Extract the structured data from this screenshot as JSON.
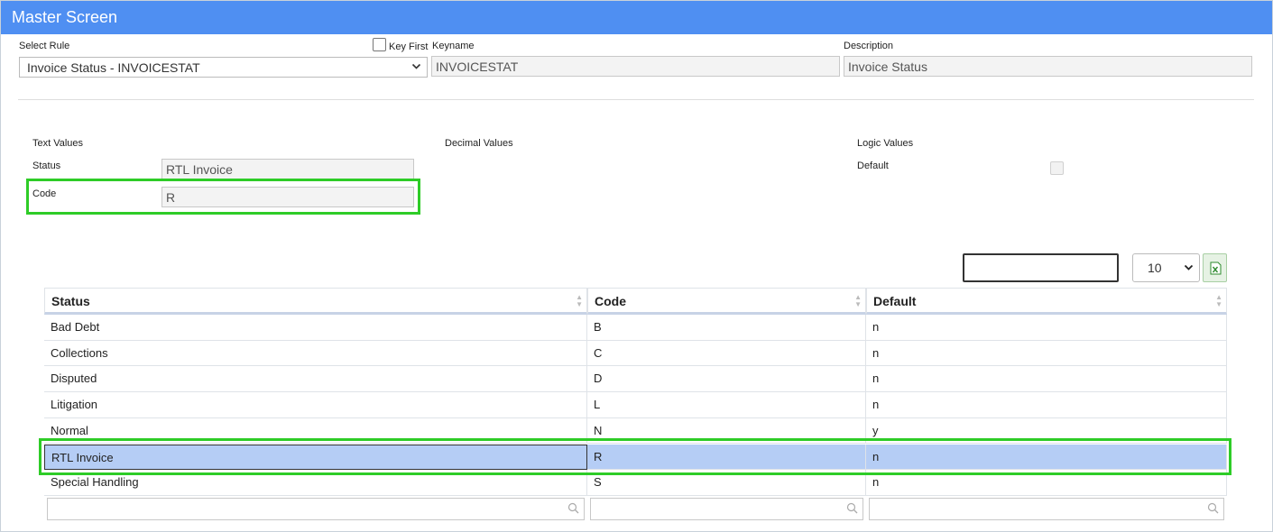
{
  "header": {
    "title": "Master Screen"
  },
  "top": {
    "select_rule_label": "Select Rule",
    "select_rule_value": "Invoice Status - INVOICESTAT",
    "key_first_label": "Key First",
    "keyname_label": "Keyname",
    "keyname_value": "INVOICESTAT",
    "description_label": "Description",
    "description_value": "Invoice Status"
  },
  "sections": {
    "text_values": "Text Values",
    "decimal_values": "Decimal Values",
    "logic_values": "Logic Values"
  },
  "form": {
    "status_label": "Status",
    "status_value": "RTL Invoice",
    "code_label": "Code",
    "code_value": "R",
    "default_label": "Default"
  },
  "grid": {
    "page_size": "10",
    "export_icon": "excel-icon",
    "columns": [
      "Status",
      "Code",
      "Default"
    ],
    "rows": [
      [
        "Bad Debt",
        "B",
        "n"
      ],
      [
        "Collections",
        "C",
        "n"
      ],
      [
        "Disputed",
        "D",
        "n"
      ],
      [
        "Litigation",
        "L",
        "n"
      ],
      [
        "Normal",
        "N",
        "y"
      ],
      [
        "RTL Invoice",
        "R",
        "n"
      ],
      [
        "Special Handling",
        "S",
        "n"
      ]
    ],
    "selected_row": 5
  },
  "colors": {
    "header": "#4f8ff2",
    "highlight": "#2ecc27",
    "selected_row": "#b5cdf5"
  }
}
